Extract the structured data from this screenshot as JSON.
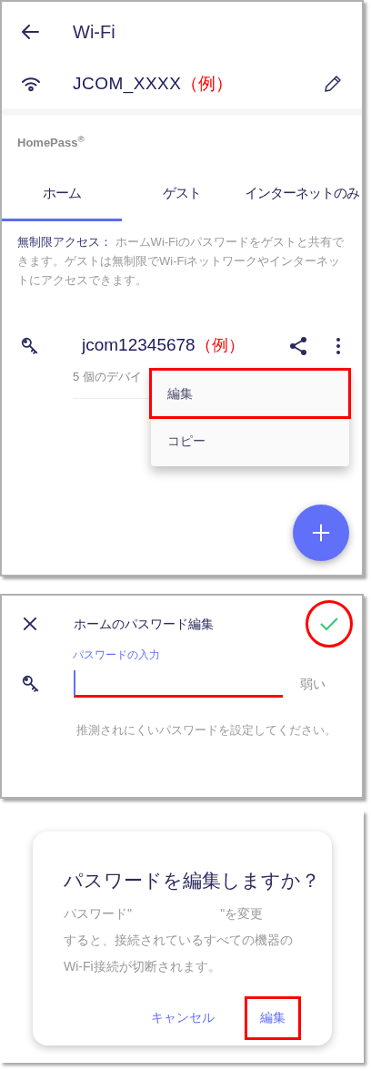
{
  "wifi_screen": {
    "title": "Wi-Fi",
    "network": {
      "name": "JCOM_XXXX",
      "note": "（例）"
    },
    "section_label": "HomePass$^{®}$",
    "tabs": [
      {
        "label": "ホーム",
        "selected": true
      },
      {
        "label": "ゲスト",
        "selected": false
      },
      {
        "label": "インターネットのみ",
        "selected": false
      }
    ],
    "description": "**無制限アクセス：** ホームWi-Fiのパスワードをゲストと共有できます。ゲストは無制限でWi-Fiネットワークやインターネットにアクセスできます。",
    "password": {
      "value": "jcom12345678",
      "note": "（例）",
      "devices": "5 個のデバイ"
    },
    "menu": [
      {
        "label": "編集",
        "highlighted": true
      },
      {
        "label": "コピー",
        "highlighted": false
      }
    ]
  },
  "edit_screen": {
    "title": "ホームのパスワード編集",
    "confirm_highlighted": true,
    "field_label": "パスワードの入力",
    "field_highlighted": true,
    "strength": "弱い",
    "hint": "推測されにくいパスワードを設定してください。"
  },
  "confirm_dialog": {
    "title": "パスワードを編集しますか？",
    "message_lines": [
      "パスワード\"                         \"を変更",
      "すると、接続されているすべての機器の",
      "Wi-Fi接続が切断されます。"
    ],
    "buttons": [
      {
        "label": "キャンセル",
        "highlighted": false
      },
      {
        "label": "編集",
        "highlighted": true
      }
    ]
  }
}
